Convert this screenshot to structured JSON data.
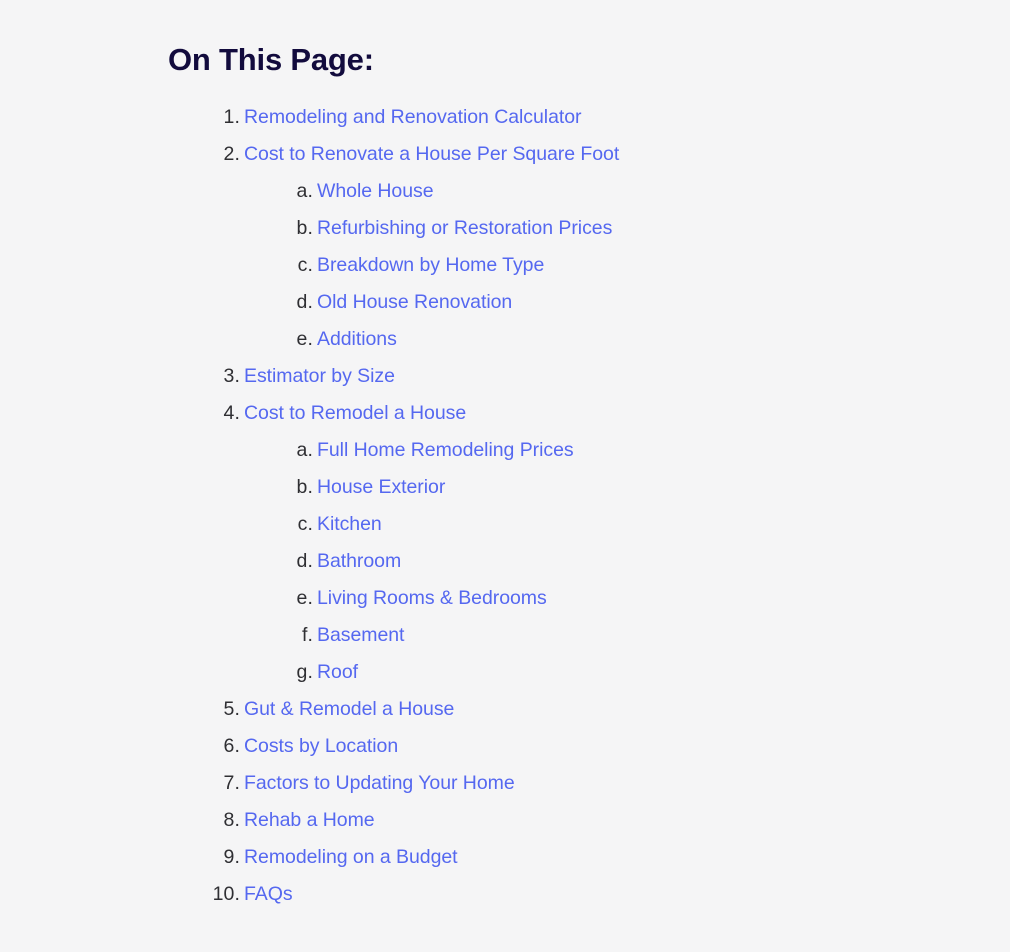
{
  "page": {
    "heading": "On This Page:",
    "background_color": "#f5f5f6",
    "link_color": "#5568f0",
    "heading_color": "#120b3d",
    "marker_color": "#2f2f33"
  },
  "toc": {
    "items": [
      {
        "marker": "1.",
        "label": "Remodeling and Renovation Calculator",
        "level": 1
      },
      {
        "marker": "2.",
        "label": "Cost to Renovate a House Per Square Foot",
        "level": 1
      },
      {
        "marker": "a.",
        "label": "Whole House",
        "level": 2
      },
      {
        "marker": "b.",
        "label": "Refurbishing or Restoration Prices",
        "level": 2
      },
      {
        "marker": "c.",
        "label": "Breakdown by Home Type",
        "level": 2
      },
      {
        "marker": "d.",
        "label": "Old House Renovation",
        "level": 2
      },
      {
        "marker": "e.",
        "label": "Additions",
        "level": 2
      },
      {
        "marker": "3.",
        "label": "Estimator by Size",
        "level": 1
      },
      {
        "marker": "4.",
        "label": "Cost to Remodel a House",
        "level": 1
      },
      {
        "marker": "a.",
        "label": "Full Home Remodeling Prices",
        "level": 2
      },
      {
        "marker": "b.",
        "label": "House Exterior",
        "level": 2
      },
      {
        "marker": "c.",
        "label": "Kitchen",
        "level": 2
      },
      {
        "marker": "d.",
        "label": "Bathroom",
        "level": 2
      },
      {
        "marker": "e.",
        "label": "Living Rooms & Bedrooms",
        "level": 2
      },
      {
        "marker": "f.",
        "label": "Basement",
        "level": 2
      },
      {
        "marker": "g.",
        "label": "Roof",
        "level": 2
      },
      {
        "marker": "5.",
        "label": "Gut & Remodel a House",
        "level": 1
      },
      {
        "marker": "6.",
        "label": "Costs by Location",
        "level": 1
      },
      {
        "marker": "7.",
        "label": "Factors to Updating Your Home",
        "level": 1
      },
      {
        "marker": "8.",
        "label": "Rehab a Home",
        "level": 1
      },
      {
        "marker": "9.",
        "label": "Remodeling on a Budget",
        "level": 1
      },
      {
        "marker": "10.",
        "label": "FAQs",
        "level": 1
      }
    ]
  }
}
